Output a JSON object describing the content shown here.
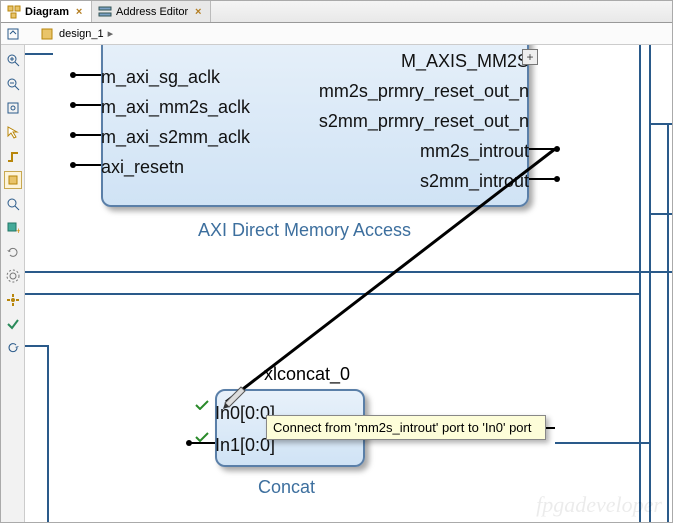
{
  "tabs": [
    {
      "label": "Diagram",
      "active": true,
      "icon": "diagram-icon"
    },
    {
      "label": "Address Editor",
      "active": false,
      "icon": "address-editor-icon"
    }
  ],
  "breadcrumb": {
    "items": [
      "design_1"
    ]
  },
  "toolbox_icons": [
    "zoom-in-icon",
    "zoom-out-icon",
    "zoom-fit-icon",
    "select-icon",
    "route-icon",
    "highlight-icon",
    "search-icon",
    "add-ip-icon",
    "refresh-icon",
    "settings-icon",
    "gear-icon",
    "validate-icon",
    "rotate-icon"
  ],
  "blocks": {
    "axi_dma": {
      "title": "AXI Direct Memory Access",
      "left_ports": [
        "m_axi_sg_aclk",
        "m_axi_mm2s_aclk",
        "m_axi_s2mm_aclk",
        "axi_resetn"
      ],
      "right_ports": [
        "M_AXIS_MM2S",
        "mm2s_prmry_reset_out_n",
        "s2mm_prmry_reset_out_n",
        "mm2s_introut",
        "s2mm_introut"
      ]
    },
    "xlconcat": {
      "instance": "xlconcat_0",
      "title": "Concat",
      "left_ports": [
        "In0[0:0]",
        "In1[0:0]"
      ]
    }
  },
  "tooltip": "Connect from 'mm2s_introut' port to 'In0' port",
  "watermark": "fpgadeveloper"
}
